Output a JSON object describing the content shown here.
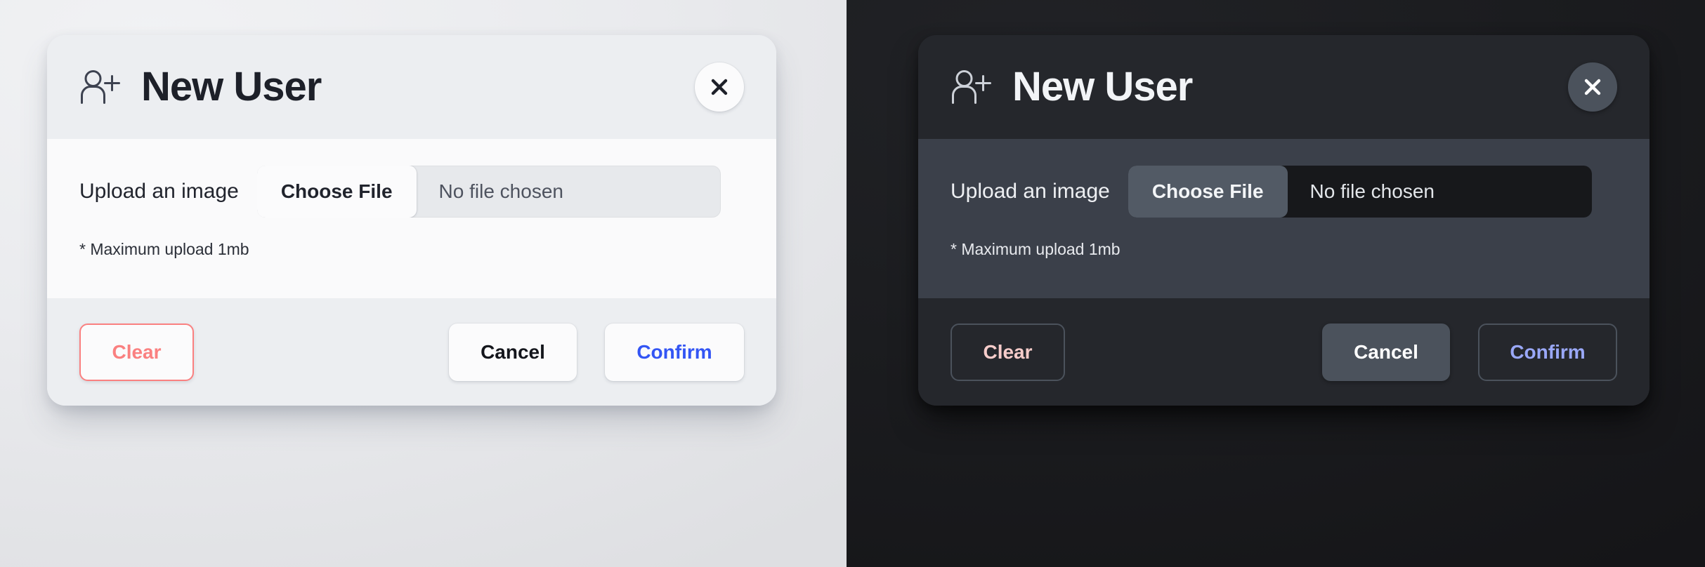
{
  "panes": [
    {
      "theme": "light",
      "dialog": {
        "icon": "user-plus-icon",
        "title": "New User",
        "close_label": "close-icon",
        "field_label": "Upload an image",
        "choose_file_label": "Choose File",
        "file_status": "No file chosen",
        "hint": "* Maximum upload 1mb",
        "buttons": {
          "clear": "Clear",
          "cancel": "Cancel",
          "confirm": "Confirm"
        }
      },
      "colors": {
        "background": "#eaebee",
        "surface": "#eceef1",
        "body_surface": "#fafafb",
        "title": "#1d2029",
        "clear_accent": "#fa8080",
        "confirm_accent": "#3355f4",
        "cancel_text": "#14161c"
      }
    },
    {
      "theme": "dark",
      "dialog": {
        "icon": "user-plus-icon",
        "title": "New User",
        "close_label": "close-icon",
        "field_label": "Upload an image",
        "choose_file_label": "Choose File",
        "file_status": "No file chosen",
        "hint": "* Maximum upload 1mb",
        "buttons": {
          "clear": "Clear",
          "cancel": "Cancel",
          "confirm": "Confirm"
        }
      },
      "colors": {
        "background": "#1b1c1f",
        "surface": "#25272c",
        "body_surface": "#3b404a",
        "title": "#f2f4f7",
        "clear_accent": "#f6ccca",
        "confirm_accent": "#9aa8f8",
        "cancel_text": "#ffffff"
      }
    }
  ]
}
